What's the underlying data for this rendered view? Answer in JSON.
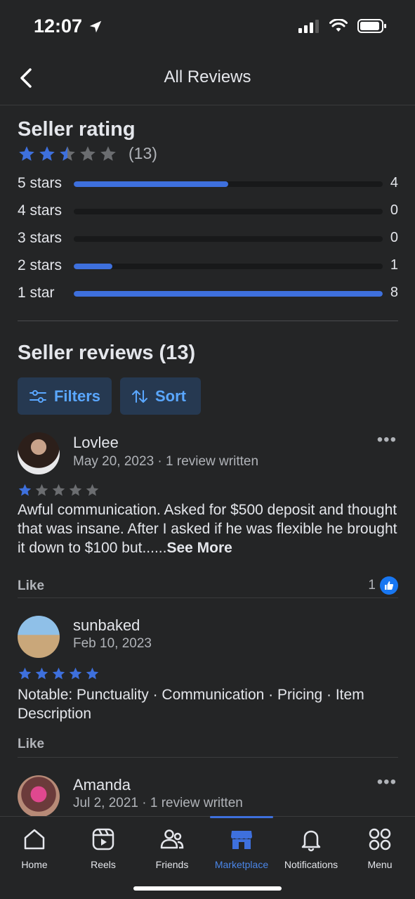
{
  "status": {
    "time": "12:07"
  },
  "header": {
    "title": "All Reviews"
  },
  "seller_rating": {
    "title": "Seller rating",
    "stars_filled": 2.5,
    "count_text": "(13)",
    "breakdown": [
      {
        "label": "5 stars",
        "count": "4",
        "fraction": 0.5
      },
      {
        "label": "4 stars",
        "count": "0",
        "fraction": 0
      },
      {
        "label": "3 stars",
        "count": "0",
        "fraction": 0
      },
      {
        "label": "2 stars",
        "count": "1",
        "fraction": 0.125
      },
      {
        "label": "1 star",
        "count": "8",
        "fraction": 1.0
      }
    ]
  },
  "seller_reviews": {
    "title": "Seller reviews (13)",
    "filters_label": "Filters",
    "sort_label": "Sort"
  },
  "reviews": [
    {
      "name": "Lovlee",
      "meta": "May 20, 2023 · 1 review written",
      "stars": 1,
      "text": "Awful communication. Asked for $500 deposit and thought that was insane. After I asked if he was flexible he brought it down to $100 but......",
      "see_more": "See More",
      "like_label": "Like",
      "like_count": "1"
    },
    {
      "name": "sunbaked",
      "meta": "Feb 10, 2023",
      "stars": 5,
      "text": "Notable: Punctuality · Communication · Pricing · Item Description",
      "like_label": "Like"
    },
    {
      "name": "Amanda",
      "meta": "Jul 2, 2021 · 1 review written"
    }
  ],
  "tabs": [
    {
      "label": "Home",
      "icon": "home-icon"
    },
    {
      "label": "Reels",
      "icon": "reels-icon"
    },
    {
      "label": "Friends",
      "icon": "friends-icon"
    },
    {
      "label": "Marketplace",
      "icon": "marketplace-icon",
      "active": true
    },
    {
      "label": "Notifications",
      "icon": "bell-icon"
    },
    {
      "label": "Menu",
      "icon": "menu-grid-icon"
    }
  ],
  "colors": {
    "accent": "#3e70dd",
    "background": "#242526",
    "star_empty": "#6b6d70"
  }
}
